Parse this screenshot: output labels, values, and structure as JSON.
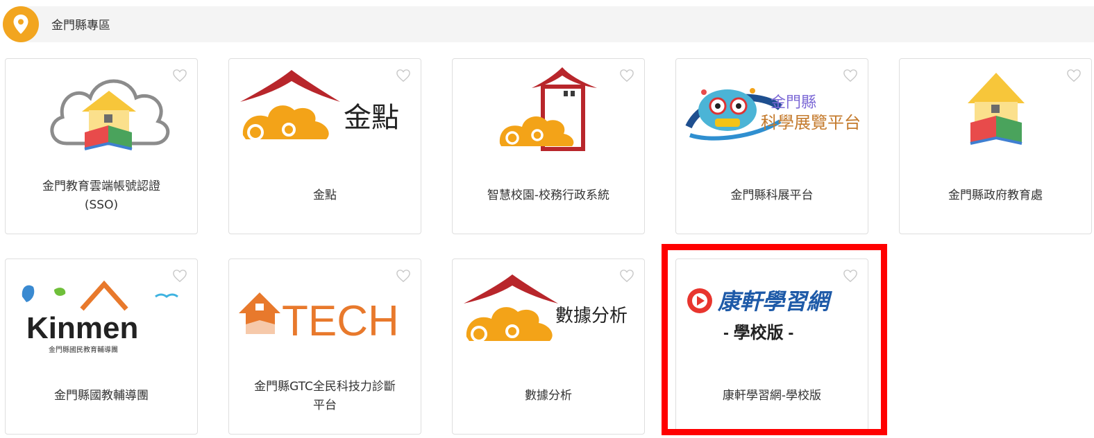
{
  "section": {
    "title": "金門縣專區",
    "icon": "location-pin-icon"
  },
  "cards": [
    {
      "label": "金門教育雲端帳號認證(SSO)",
      "logo": "cloud-house-book-logo"
    },
    {
      "label": "金點",
      "logo": "jindian-roof-cloud-logo",
      "logo_text": "金點"
    },
    {
      "label": "智慧校園-校務行政系統",
      "logo": "roof-house-cloud-logo"
    },
    {
      "label": "金門縣科展平台",
      "logo": "lion-mask-science-fair-logo",
      "logo_text_line1": "金門縣",
      "logo_text_line2": "科學展覽平台"
    },
    {
      "label": "金門縣政府教育處",
      "logo": "house-book-logo"
    },
    {
      "label": "金門縣國教輔導團",
      "logo": "kinmen-logo",
      "logo_text": "Kinmen",
      "logo_subtext": "金門縣國民教育輔導團"
    },
    {
      "label": "金門縣GTC全民科技力診斷平台",
      "logo": "gtc-tech-logo",
      "logo_text": "TECH"
    },
    {
      "label": "數據分析",
      "logo": "data-analysis-roof-cloud-logo",
      "logo_text": "數據分析"
    },
    {
      "label": "康軒學習網-學校版",
      "logo": "kangxuan-play-logo",
      "logo_text": "康軒學習網",
      "logo_subtext": "- 學校版 -"
    }
  ],
  "colors": {
    "accent": "#f2a51f",
    "roof_red": "#b8262b",
    "cloud_orange": "#f3a318",
    "tech_orange": "#e8792c",
    "kangxuan_blue": "#1e5aa8",
    "highlight": "#ff0000"
  }
}
